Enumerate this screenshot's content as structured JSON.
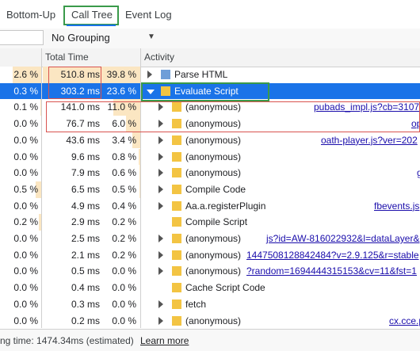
{
  "tabs": [
    {
      "label": "Bottom-Up",
      "active": false
    },
    {
      "label": "Call Tree",
      "active": true
    },
    {
      "label": "Event Log",
      "active": false
    }
  ],
  "toolbar": {
    "filter_value": "",
    "grouping": "No Grouping"
  },
  "columns": {
    "total_time": "Total Time",
    "activity": "Activity"
  },
  "rows": [
    {
      "self_pct": "2.6 %",
      "total_ms": "510.8 ms",
      "total_pct": "39.8 %",
      "activity": "Parse HTML",
      "icon_color": "#6f9ed8",
      "expanded": false,
      "selected": false,
      "link": ""
    },
    {
      "self_pct": "0.3 %",
      "total_ms": "303.2 ms",
      "total_pct": "23.6 %",
      "activity": "Evaluate Script",
      "icon_color": "#f3c443",
      "expanded": true,
      "selected": true,
      "link": ""
    },
    {
      "self_pct": "0.1 %",
      "total_ms": "141.0 ms",
      "total_pct": "11.0 %",
      "activity": "(anonymous)",
      "icon_color": "#f3c443",
      "expanded": false,
      "selected": false,
      "link": "pubads_impl.js?cb=3107"
    },
    {
      "self_pct": "0.0 %",
      "total_ms": "76.7 ms",
      "total_pct": "6.0 %",
      "activity": "(anonymous)",
      "icon_color": "#f3c443",
      "expanded": false,
      "selected": false,
      "link": "op"
    },
    {
      "self_pct": "0.0 %",
      "total_ms": "43.6 ms",
      "total_pct": "3.4 %",
      "activity": "(anonymous)",
      "icon_color": "#f3c443",
      "expanded": false,
      "selected": false,
      "link": "oath-player.js?ver=202"
    },
    {
      "self_pct": "0.0 %",
      "total_ms": "9.6 ms",
      "total_pct": "0.8 %",
      "activity": "(anonymous)",
      "icon_color": "#f3c443",
      "expanded": false,
      "selected": false,
      "link": ""
    },
    {
      "self_pct": "0.0 %",
      "total_ms": "7.9 ms",
      "total_pct": "0.6 %",
      "activity": "(anonymous)",
      "icon_color": "#f3c443",
      "expanded": false,
      "selected": false,
      "link": "g"
    },
    {
      "self_pct": "0.5 %",
      "total_ms": "6.5 ms",
      "total_pct": "0.5 %",
      "activity": "Compile Code",
      "icon_color": "#f3c443",
      "expanded": false,
      "selected": false,
      "link": ""
    },
    {
      "self_pct": "0.0 %",
      "total_ms": "4.9 ms",
      "total_pct": "0.4 %",
      "activity": "Aa.a.registerPlugin",
      "icon_color": "#f3c443",
      "expanded": false,
      "selected": false,
      "link": "fbevents.js"
    },
    {
      "self_pct": "0.2 %",
      "total_ms": "2.9 ms",
      "total_pct": "0.2 %",
      "activity": "Compile Script",
      "icon_color": "#f3c443",
      "expanded": false,
      "selected": false,
      "link": ""
    },
    {
      "self_pct": "0.0 %",
      "total_ms": "2.5 ms",
      "total_pct": "0.2 %",
      "activity": "(anonymous)",
      "icon_color": "#f3c443",
      "expanded": false,
      "selected": false,
      "link": "js?id=AW-816022932&l=dataLayer&"
    },
    {
      "self_pct": "0.0 %",
      "total_ms": "2.1 ms",
      "total_pct": "0.2 %",
      "activity": "(anonymous)",
      "icon_color": "#f3c443",
      "expanded": false,
      "selected": false,
      "link": "1447508128842484?v=2.9.125&r=stable"
    },
    {
      "self_pct": "0.0 %",
      "total_ms": "0.5 ms",
      "total_pct": "0.0 %",
      "activity": "(anonymous)",
      "icon_color": "#f3c443",
      "expanded": false,
      "selected": false,
      "link": "?random=1694444315153&cv=11&fst=1"
    },
    {
      "self_pct": "0.0 %",
      "total_ms": "0.4 ms",
      "total_pct": "0.0 %",
      "activity": "Cache Script Code",
      "icon_color": "#f3c443",
      "expanded": false,
      "selected": false,
      "link": ""
    },
    {
      "self_pct": "0.0 %",
      "total_ms": "0.3 ms",
      "total_pct": "0.0 %",
      "activity": "fetch",
      "icon_color": "#f3c443",
      "expanded": false,
      "selected": false,
      "link": ""
    },
    {
      "self_pct": "0.0 %",
      "total_ms": "0.2 ms",
      "total_pct": "0.0 %",
      "activity": "(anonymous)",
      "icon_color": "#f3c443",
      "expanded": false,
      "selected": false,
      "link": "cx.cce.p"
    }
  ],
  "footer": {
    "status": "ng time: 1474.34ms (estimated)",
    "learn_more": "Learn more"
  }
}
